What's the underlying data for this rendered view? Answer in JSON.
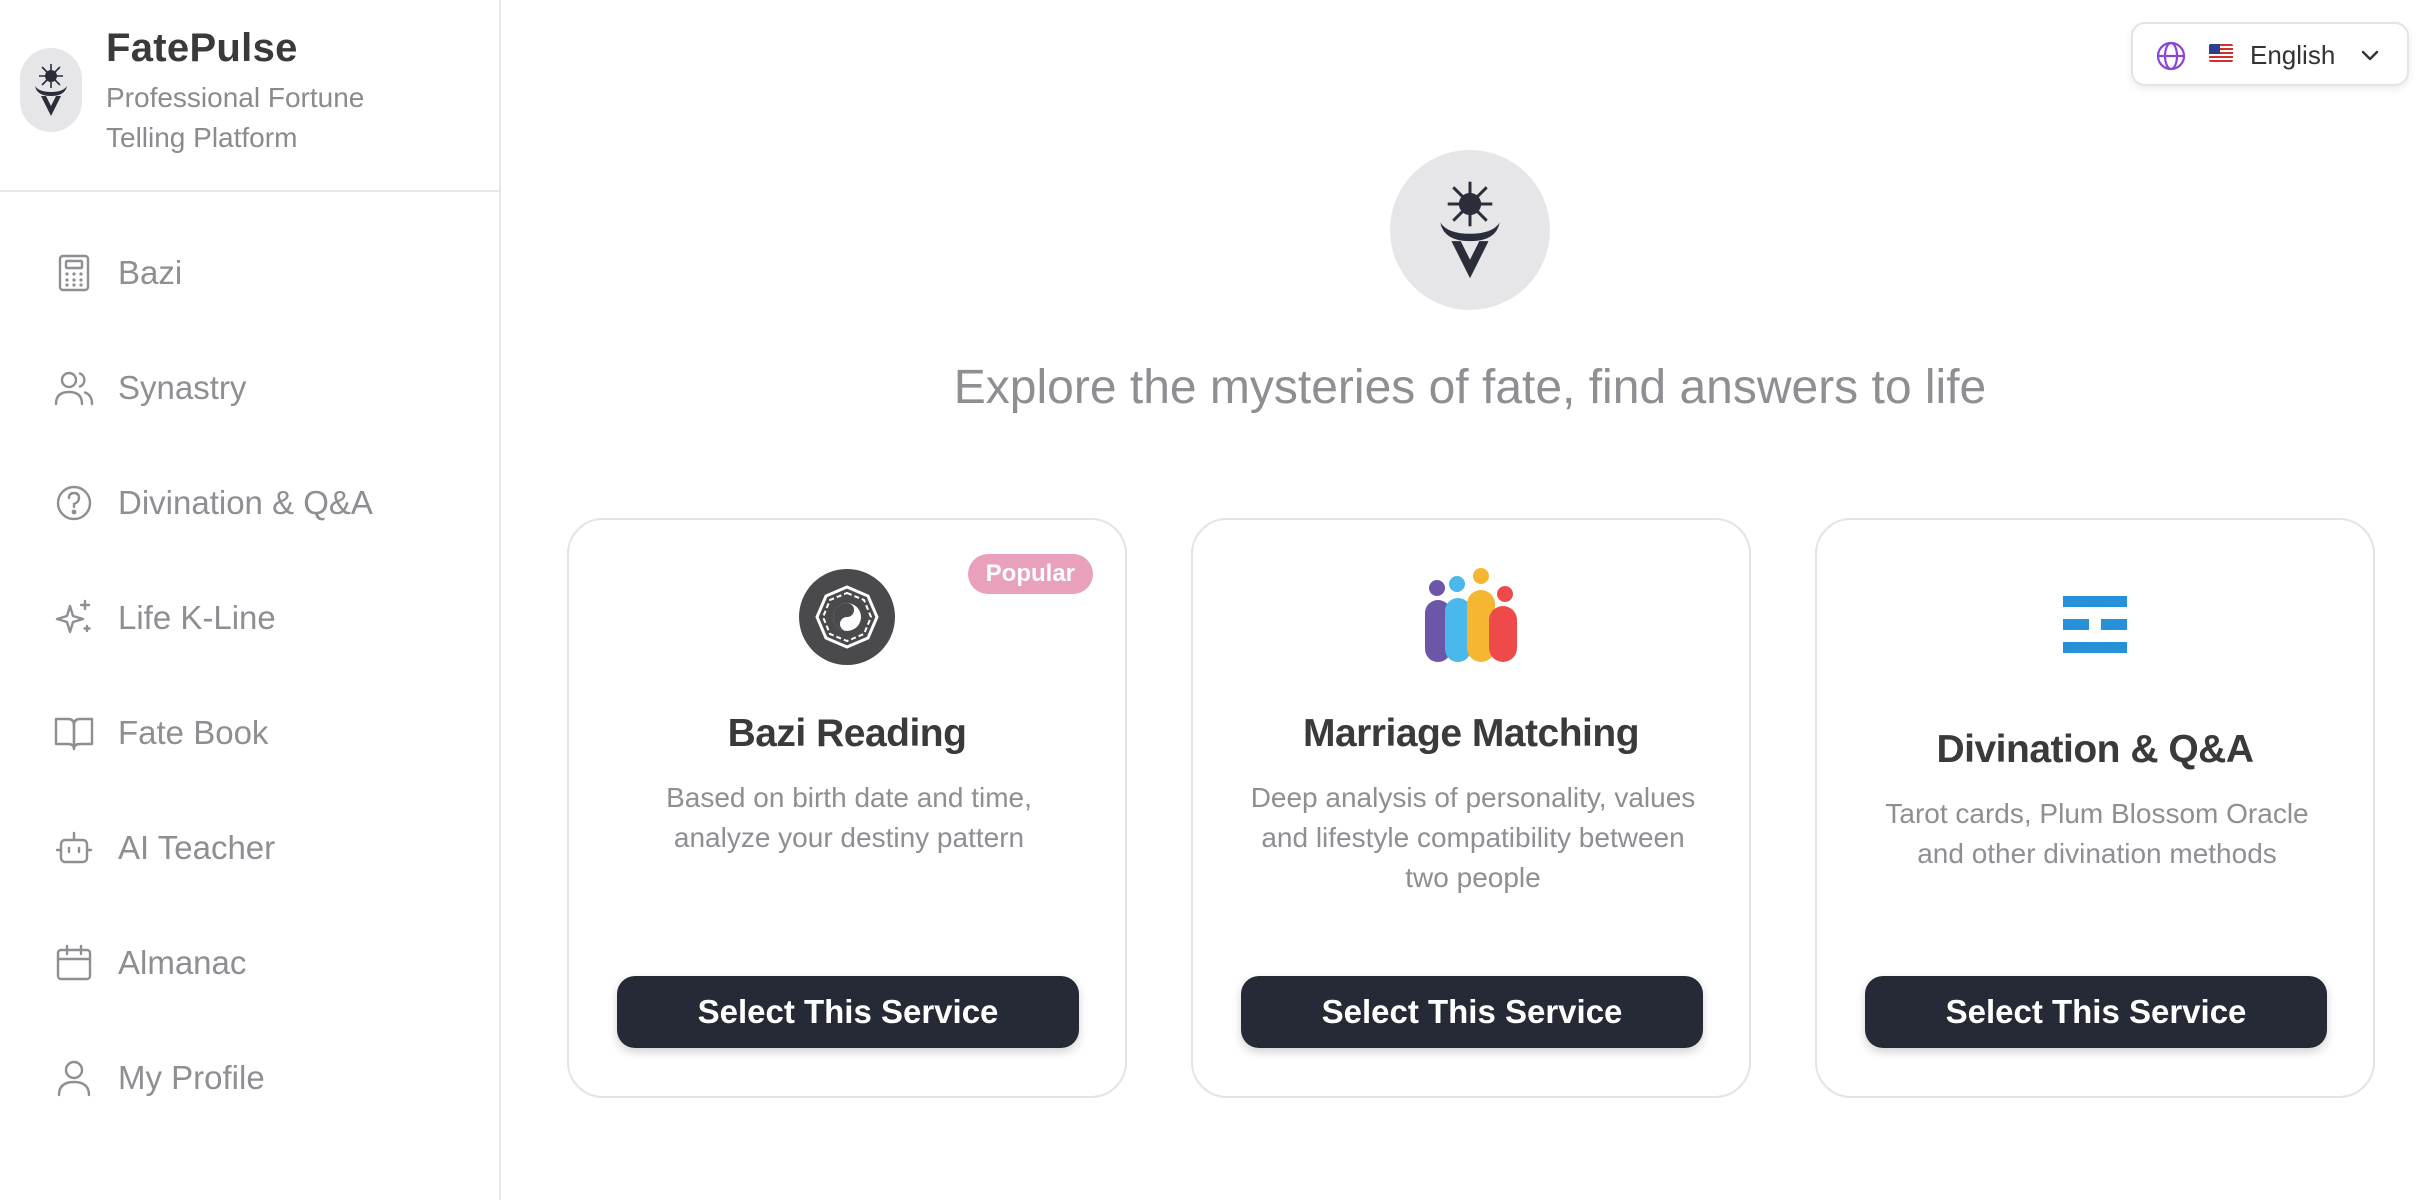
{
  "brand": {
    "title": "FatePulse",
    "subtitle": "Professional Fortune Telling Platform",
    "logo_icon": "lotus-sun-logo-icon"
  },
  "sidebar": {
    "items": [
      {
        "label": "Bazi",
        "icon": "calculator-icon"
      },
      {
        "label": "Synastry",
        "icon": "users-icon"
      },
      {
        "label": "Divination & Q&A",
        "icon": "help-circle-icon"
      },
      {
        "label": "Life K-Line",
        "icon": "sparkles-icon"
      },
      {
        "label": "Fate Book",
        "icon": "book-open-icon"
      },
      {
        "label": "AI Teacher",
        "icon": "robot-icon"
      },
      {
        "label": "Almanac",
        "icon": "calendar-icon"
      },
      {
        "label": "My Profile",
        "icon": "user-icon"
      }
    ]
  },
  "language": {
    "selected": "English",
    "flag": "us-flag-icon",
    "icon": "globe-icon"
  },
  "hero": {
    "tagline": "Explore the mysteries of fate, find answers to life"
  },
  "services": [
    {
      "title": "Bazi Reading",
      "description": "Based on birth date and time, analyze your destiny pattern",
      "badge": "Popular",
      "button": "Select This Service",
      "icon": "bagua-yin-yang-icon"
    },
    {
      "title": "Marriage Matching",
      "description": "Deep analysis of personality, values and lifestyle compatibility between two people",
      "button": "Select This Service",
      "icon": "family-people-icon"
    },
    {
      "title": "Divination & Q&A",
      "description": "Tarot cards, Plum Blossom Oracle and other divination methods",
      "button": "Select This Service",
      "icon": "trigram-icon"
    }
  ],
  "colors": {
    "accent_dark": "#262a36",
    "badge_pink": "#e8a0bd",
    "trigram_blue": "#2690d8",
    "globe_purple": "#8b45d6"
  }
}
